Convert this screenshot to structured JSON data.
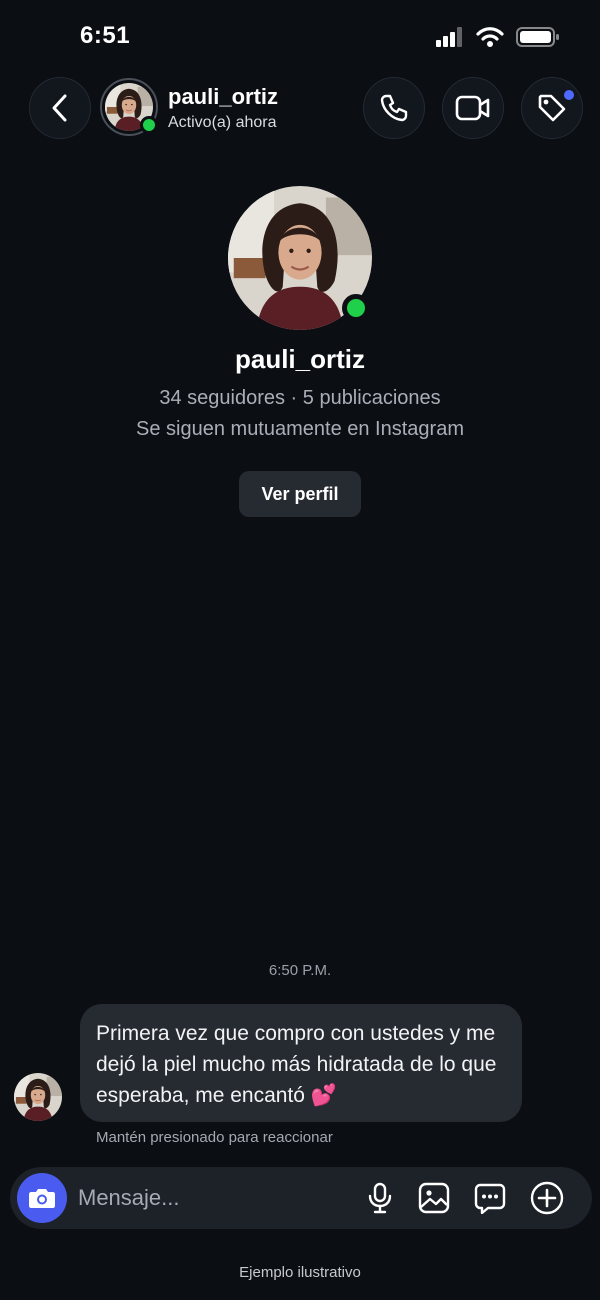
{
  "status_bar": {
    "time": "6:51"
  },
  "header": {
    "username": "pauli_ortiz",
    "status": "Activo(a) ahora",
    "icons": [
      "back-icon",
      "phone-icon",
      "video-icon",
      "tag-icon"
    ]
  },
  "profile": {
    "username": "pauli_ortiz",
    "stats": "34 seguidores · 5 publicaciones",
    "mutual": "Se siguen mutuamente en Instagram",
    "view_profile_label": "Ver perfil"
  },
  "conversation": {
    "timestamp": "6:50 P.M.",
    "message_text": "Primera vez que compro con ustedes y me dejó la piel mucho más hidratada de lo que esperaba, me encantó 💕",
    "hint": "Mantén presionado para reaccionar"
  },
  "composer": {
    "placeholder": "Mensaje...",
    "icons": [
      "camera-icon",
      "microphone-icon",
      "gallery-icon",
      "sticker-icon",
      "plus-icon"
    ]
  },
  "footer_note": "Ejemplo ilustrativo",
  "colors": {
    "background": "#0b0e13",
    "bubble": "#262a31",
    "online": "#1fd14a",
    "accent": "#4a5cf0",
    "notification": "#4f6bff"
  }
}
